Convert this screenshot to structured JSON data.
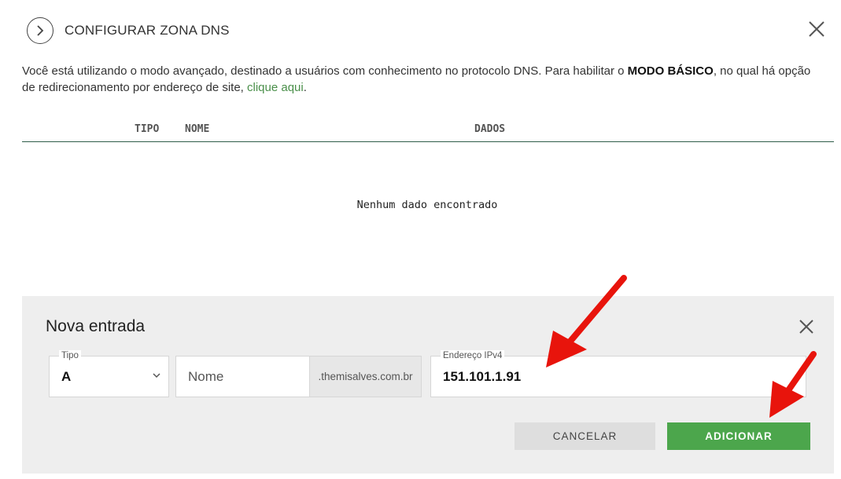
{
  "header": {
    "title": "CONFIGURAR ZONA DNS"
  },
  "intro": {
    "text_before": "Você está utilizando o modo avançado, destinado a usuários com conhecimento no protocolo DNS. Para habilitar o ",
    "bold": "MODO BÁSICO",
    "text_after": ", no qual há opção de redirecionamento por endereço de site, ",
    "link": "clique aqui",
    "end": "."
  },
  "table": {
    "columns": [
      "TIPO",
      "NOME",
      "DADOS"
    ],
    "empty_message": "Nenhum dado encontrado"
  },
  "new_entry": {
    "title": "Nova entrada",
    "type_label": "Tipo",
    "type_value": "A",
    "name_placeholder": "Nome",
    "domain_suffix": ".themisalves.com.br",
    "ip_label": "Endereço IPv4",
    "ip_value": "151.101.1.91",
    "cancel_label": "CANCELAR",
    "add_label": "ADICIONAR"
  },
  "colors": {
    "accent_green": "#4ca64c",
    "link_green": "#4a8f4a",
    "annotation_red": "#e8140c"
  }
}
